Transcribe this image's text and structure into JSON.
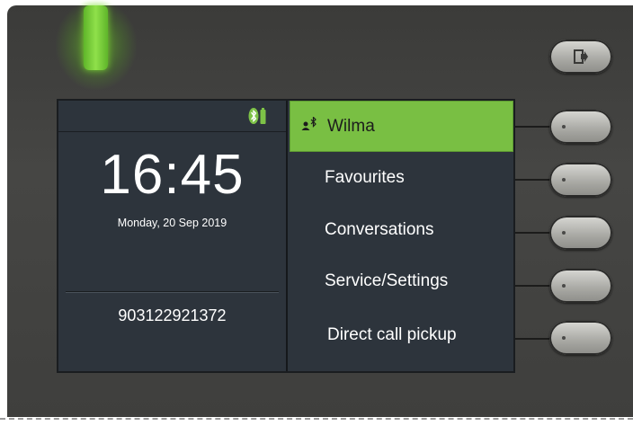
{
  "status": {
    "icons": [
      "bluetooth-icon",
      "battery-icon"
    ]
  },
  "clock": {
    "time": "16:45",
    "date": "Monday, 20 Sep 2019"
  },
  "phone_number": "903122921372",
  "menu": {
    "items": [
      {
        "label": "Wilma",
        "active": true,
        "icon": "user-bluetooth-icon"
      },
      {
        "label": "Favourites",
        "active": false
      },
      {
        "label": "Conversations",
        "active": false
      },
      {
        "label": "Service/Settings",
        "active": false
      },
      {
        "label": "Direct call pickup",
        "active": false
      }
    ]
  },
  "hardware": {
    "exit_key_icon": "exit-icon",
    "led_color": "#79bf43"
  },
  "colors": {
    "accent": "#79bf43",
    "screen_bg": "#2d343c"
  }
}
